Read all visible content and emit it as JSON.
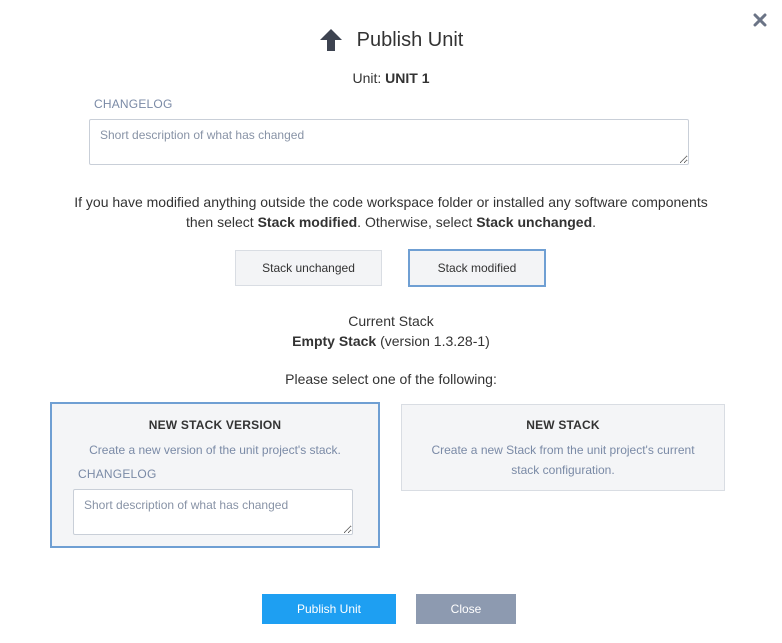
{
  "dialog": {
    "title": "Publish Unit",
    "icon": "arrow-up-icon",
    "close_icon": "close-icon"
  },
  "unit": {
    "label": "Unit:",
    "name": "UNIT 1"
  },
  "changelog": {
    "label": "CHANGELOG",
    "placeholder": "Short description of what has changed",
    "value": ""
  },
  "info": {
    "line1": "If you have modified anything outside the code workspace folder or installed any software components",
    "then_select": "then select",
    "stack_modified": "Stack modified",
    "otherwise": ". Otherwise, select",
    "stack_unchanged": "Stack unchanged",
    "period": "."
  },
  "stack_choice": {
    "unchanged_label": "Stack unchanged",
    "modified_label": "Stack modified",
    "selected": "modified"
  },
  "current_stack": {
    "heading": "Current Stack",
    "name": "Empty Stack",
    "version": "(version 1.3.28-1)"
  },
  "options": {
    "prompt": "Please select one of the following:",
    "new_version": {
      "title": "NEW STACK VERSION",
      "description": "Create a new version of the unit project's stack.",
      "changelog_label": "CHANGELOG",
      "changelog_placeholder": "Short description of what has changed",
      "selected": true
    },
    "new_stack": {
      "title": "NEW STACK",
      "description_line1": "Create a new Stack from the unit project's current",
      "description_line2": "stack configuration.",
      "selected": false
    }
  },
  "actions": {
    "publish_label": "Publish Unit",
    "close_label": "Close"
  },
  "colors": {
    "accent": "#1e9ff2",
    "selected_border": "#6f9fd3",
    "secondary_button": "#8d9ab0",
    "muted_text": "#7a8aa6"
  }
}
